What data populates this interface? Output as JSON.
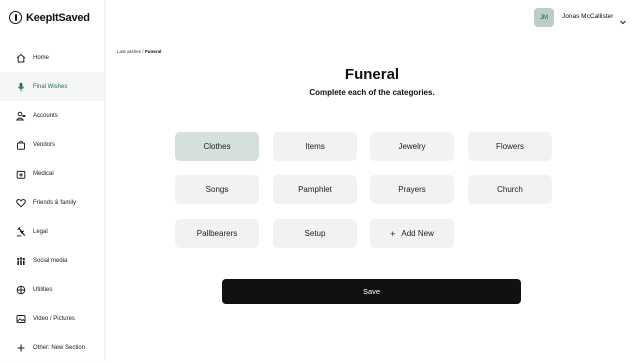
{
  "app": {
    "logo_text": "KeepItSaved"
  },
  "sidebar": {
    "items": [
      {
        "label": "Home",
        "icon": "home-icon"
      },
      {
        "label": "Final Wishes",
        "icon": "microphone-icon",
        "active": true
      },
      {
        "label": "Accounts",
        "icon": "bank-user-icon"
      },
      {
        "label": "Vendors",
        "icon": "shopping-bag-icon"
      },
      {
        "label": "Medical",
        "icon": "medical-kit-icon"
      },
      {
        "label": "Friends & family",
        "icon": "heart-icon"
      },
      {
        "label": "Legal",
        "icon": "gavel-icon"
      },
      {
        "label": "Social media",
        "icon": "people-icon"
      },
      {
        "label": "Utilities",
        "icon": "utilities-icon"
      },
      {
        "label": "Video / Pictures",
        "icon": "picture-icon"
      },
      {
        "label": "Other: New Section",
        "icon": "plus-icon"
      }
    ]
  },
  "header": {
    "avatar_initials": "JM",
    "user_name": "Jonas McCallister"
  },
  "breadcrumb": {
    "parent": "Last wishes",
    "separator": " / ",
    "current": "Funeral"
  },
  "main": {
    "title": "Funeral",
    "subtitle": "Complete each of the categories.",
    "categories": [
      {
        "label": "Clothes",
        "selected": true
      },
      {
        "label": "Items"
      },
      {
        "label": "Jewelry"
      },
      {
        "label": "Flowers"
      },
      {
        "label": "Songs"
      },
      {
        "label": "Pamphlet"
      },
      {
        "label": "Prayers"
      },
      {
        "label": "Church"
      },
      {
        "label": "Pallbearers"
      },
      {
        "label": "Setup"
      }
    ],
    "add_new_label": "Add New",
    "save_label": "Save"
  },
  "colors": {
    "accent_green": "#2d6b4f",
    "selected_tile": "#d5e0dd",
    "tile": "#f2f2f2",
    "save_button": "#111111"
  }
}
